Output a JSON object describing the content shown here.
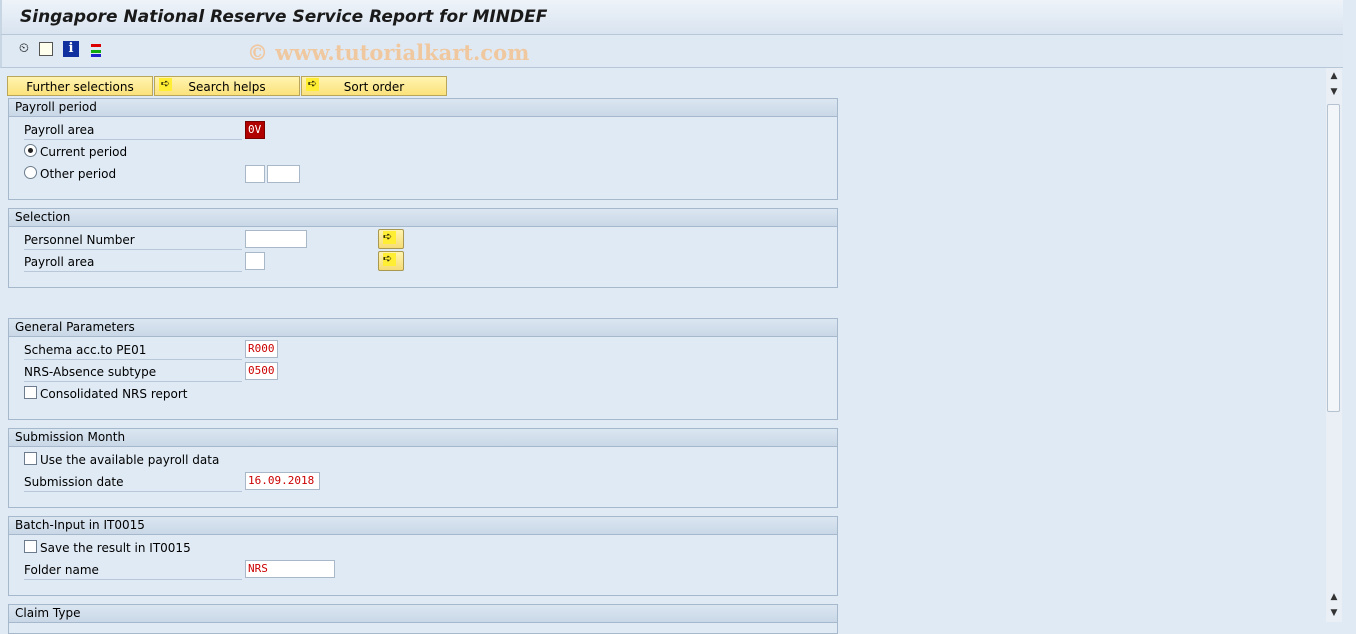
{
  "title": "Singapore National Reserve Service Report for MINDEF",
  "toolbar": {
    "icons": [
      "execute-icon",
      "get-variant-icon",
      "info-icon",
      "selection-options-icon"
    ]
  },
  "watermark": "© www.tutorialkart.com",
  "tabs": [
    {
      "label": "Further selections"
    },
    {
      "label": "Search helps"
    },
    {
      "label": "Sort order"
    }
  ],
  "payroll_period": {
    "header": "Payroll period",
    "payroll_area_label": "Payroll area",
    "payroll_area_value": "0V",
    "current_period": "Current period",
    "other_period": "Other period",
    "selected": "current"
  },
  "selection": {
    "header": "Selection",
    "personnel_number": "Personnel Number",
    "payroll_area": "Payroll area"
  },
  "general": {
    "header": "General Parameters",
    "schema_label": "Schema acc.to PE01",
    "schema_value": "R000",
    "absence_label": "NRS-Absence subtype",
    "absence_value": "0500",
    "consolidated": "Consolidated NRS report"
  },
  "submission": {
    "header": "Submission Month",
    "use_payroll": "Use the available payroll data",
    "date_label": "Submission date",
    "date_value": "16.09.2018"
  },
  "batch": {
    "header": "Batch-Input in IT0015",
    "save_result": "Save the result in IT0015",
    "folder_label": "Folder name",
    "folder_value": "NRS"
  },
  "claim": {
    "header": "Claim Type"
  }
}
